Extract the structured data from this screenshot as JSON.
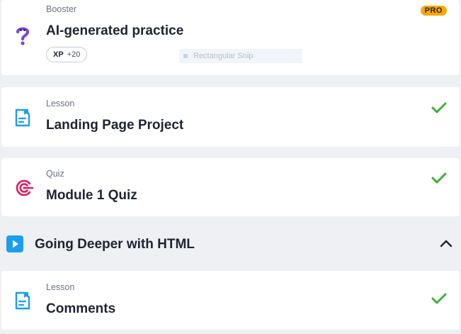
{
  "colors": {
    "accent": "#1a9ef0",
    "check": "#3fae39",
    "pro": "#f6a800",
    "quiz": "#e0195f",
    "booster": "#7b45d6"
  },
  "items": [
    {
      "type": "Booster",
      "title": "AI-generated practice",
      "badge": "PRO",
      "xp_label": "XP",
      "xp_value": "+20",
      "icon": "question-mark-icon",
      "completed": false
    },
    {
      "type": "Lesson",
      "title": "Landing Page Project",
      "icon": "lesson-document-icon",
      "completed": true
    },
    {
      "type": "Quiz",
      "title": "Module 1 Quiz",
      "icon": "quiz-target-icon",
      "completed": true
    }
  ],
  "overlay": {
    "snip_label": "Rectangular Snip"
  },
  "section": {
    "title": "Going Deeper with HTML",
    "icon": "play-icon",
    "expanded": true,
    "toggle_icon": "chevron-up-icon"
  },
  "section_items": [
    {
      "type": "Lesson",
      "title": "Comments",
      "icon": "lesson-document-icon",
      "completed": true
    }
  ]
}
